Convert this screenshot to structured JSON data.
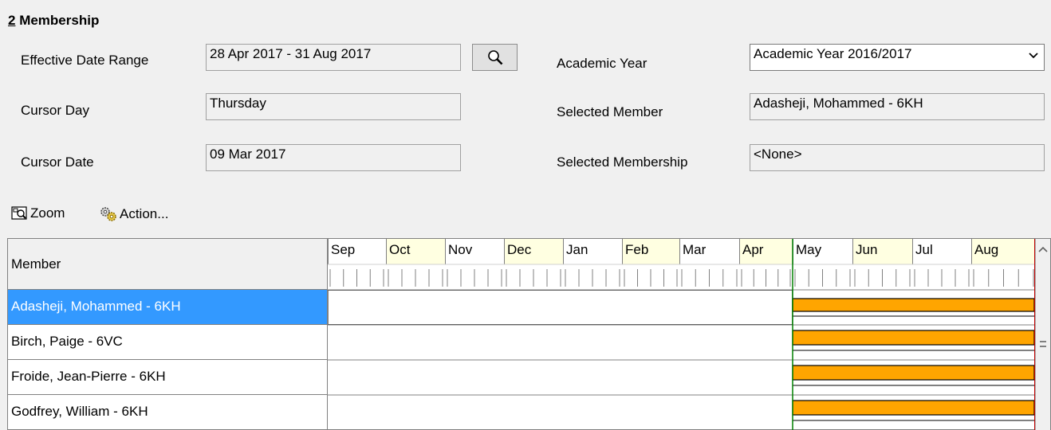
{
  "section": {
    "number": "2",
    "title": " Membership"
  },
  "fields": {
    "effective_date_range": {
      "label": "Effective Date Range",
      "value": "28 Apr 2017 - 31 Aug 2017"
    },
    "cursor_day": {
      "label": "Cursor Day",
      "value": "Thursday"
    },
    "cursor_date": {
      "label": "Cursor Date",
      "value": "09 Mar 2017"
    },
    "academic_year": {
      "label": "Academic Year",
      "value": "Academic Year 2016/2017"
    },
    "selected_member": {
      "label": "Selected Member",
      "value": "Adasheji, Mohammed - 6KH"
    },
    "selected_membership": {
      "label": "Selected Membership",
      "value": "<None>"
    }
  },
  "toolbar": {
    "zoom_label": "Zoom",
    "action_label": "Action..."
  },
  "grid": {
    "member_header": "Member",
    "months": [
      "Sep",
      "Oct",
      "Nov",
      "Dec",
      "Jan",
      "Feb",
      "Mar",
      "Apr",
      "May",
      "Jun",
      "Jul",
      "Aug"
    ],
    "members": [
      "Adasheji, Mohammed - 6KH",
      "Birch, Paige - 6VC",
      "Froide, Jean-Pierre - 6KH",
      "Godfrey, William - 6KH"
    ],
    "selected_index": 0
  },
  "colors": {
    "membership_bar": "#ffa500",
    "selection": "#3399ff",
    "alt_month": "#ffffe1",
    "range_start_line": "#008000",
    "range_end_line": "#c00000"
  }
}
